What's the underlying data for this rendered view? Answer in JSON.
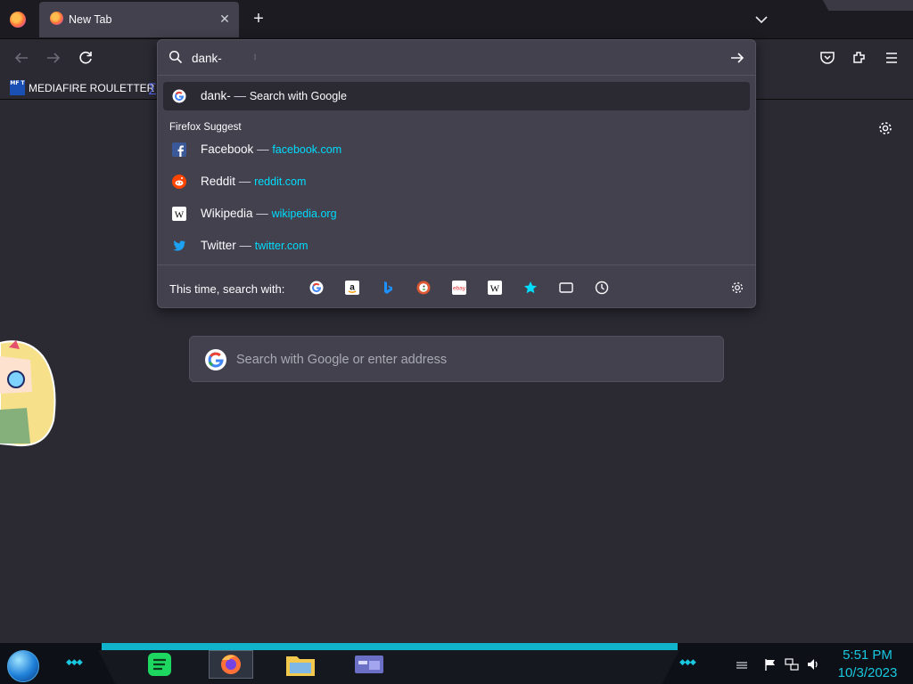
{
  "tab": {
    "title": "New Tab",
    "close_glyph": "✕"
  },
  "newtab_glyph": "+",
  "bookmarks": {
    "item_label": "MEDIAFIRE ROULETTER",
    "icon_text": "MF T"
  },
  "urlbar": {
    "typed_text": "dank-",
    "results": [
      {
        "title": "dank-",
        "action": "Search with Google",
        "icon": "google-icon",
        "selected": true
      }
    ],
    "suggest_label": "Firefox Suggest",
    "suggestions": [
      {
        "title": "Facebook",
        "url": "facebook.com",
        "icon": "facebook-icon"
      },
      {
        "title": "Reddit",
        "url": "reddit.com",
        "icon": "reddit-icon"
      },
      {
        "title": "Wikipedia",
        "url": "wikipedia.org",
        "icon": "wikipedia-icon"
      },
      {
        "title": "Twitter",
        "url": "twitter.com",
        "icon": "twitter-icon"
      }
    ],
    "separator": "—",
    "oneoff_label": "This time, search with:",
    "engines": [
      "google-icon",
      "amazon-icon",
      "bing-icon",
      "duckduckgo-icon",
      "ebay-icon",
      "wikipedia-icon",
      "bookmarks-star-icon",
      "tabs-icon",
      "history-icon"
    ]
  },
  "page": {
    "search_placeholder": "Search with Google or enter address"
  },
  "taskbar": {
    "time": "5:51 PM",
    "date": "10/3/2023"
  },
  "colors": {
    "accent_link": "#00ddff",
    "toolbar_bg": "#2b2a33",
    "popup_bg": "#42414d",
    "taskbar_accent": "#19c8e0"
  }
}
